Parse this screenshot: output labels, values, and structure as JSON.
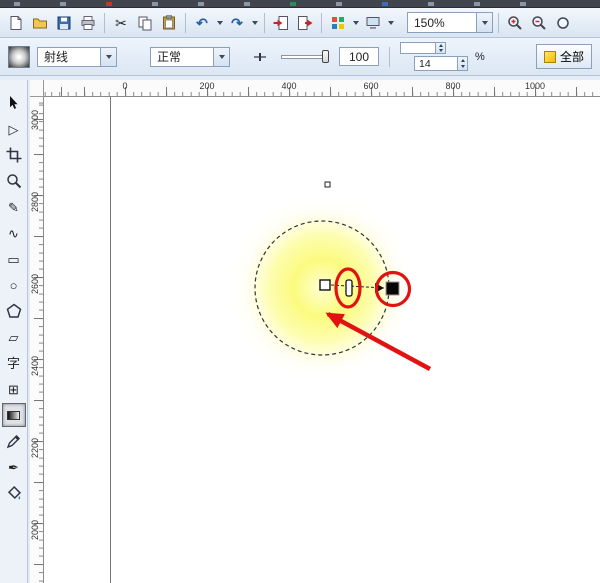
{
  "standard_toolbar": {
    "zoom_level": "150%",
    "icons": {
      "undo": "↶",
      "redo": "↷",
      "cut": "✂"
    }
  },
  "property_bar": {
    "fill_type": "射线",
    "blend_mode": "正常",
    "midpoint": "100",
    "edge_pad": "14",
    "percent": "%",
    "apply_all": "全部"
  },
  "rulers": {
    "horizontal": [
      "0",
      "200",
      "400",
      "600",
      "800",
      "1000"
    ],
    "vertical": [
      "3000",
      "2800",
      "2600",
      "2400",
      "2200",
      "2000"
    ]
  },
  "toolbox": {
    "tools": [
      {
        "name": "pick-tool"
      },
      {
        "name": "shape-tool",
        "glyph": "▷"
      },
      {
        "name": "crop-tool"
      },
      {
        "name": "zoom-tool"
      },
      {
        "name": "freehand-tool",
        "glyph": "✎"
      },
      {
        "name": "artistic-media-tool",
        "glyph": "∿"
      },
      {
        "name": "rectangle-tool",
        "glyph": "▭"
      },
      {
        "name": "ellipse-tool",
        "glyph": "○"
      },
      {
        "name": "polygon-tool"
      },
      {
        "name": "basic-shapes-tool",
        "glyph": "▱"
      },
      {
        "name": "text-tool",
        "glyph": "字"
      },
      {
        "name": "table-tool",
        "glyph": "⊞"
      },
      {
        "name": "interactive-fill-tool",
        "active": true
      },
      {
        "name": "color-eyedropper-tool"
      },
      {
        "name": "outline-pen-tool",
        "glyph": "✒"
      },
      {
        "name": "fill-tool"
      }
    ]
  },
  "canvas": {
    "colors": {
      "glow_center": "#ffffd2",
      "glow_mid": "#fbfb80",
      "annotation_red": "#e31212"
    }
  }
}
